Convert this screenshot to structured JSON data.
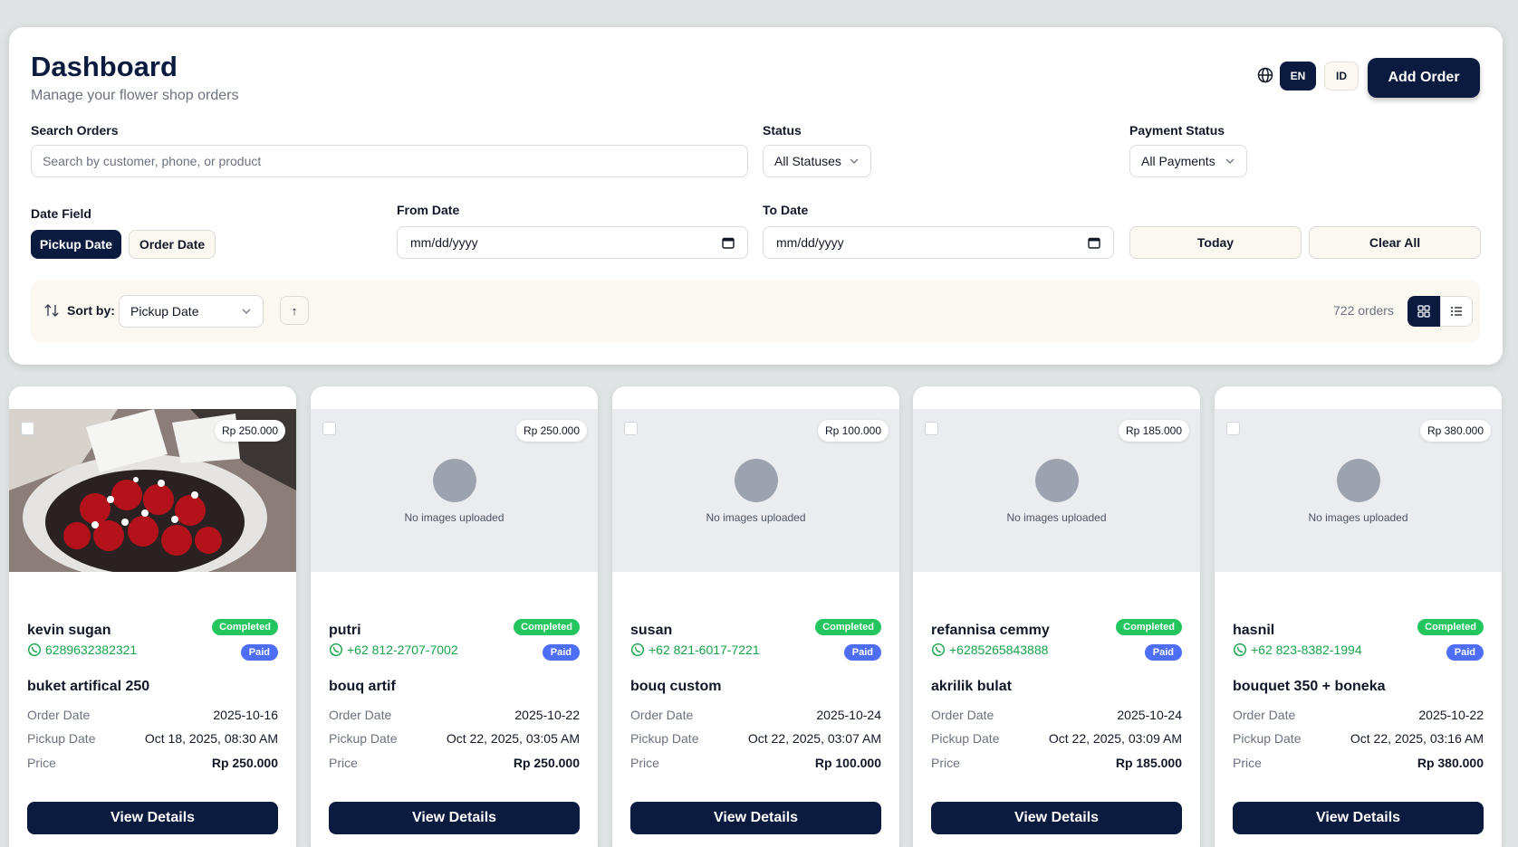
{
  "header": {
    "title": "Dashboard",
    "subtitle": "Manage your flower shop orders",
    "lang_en": "EN",
    "lang_id": "ID",
    "add_order": "Add Order"
  },
  "filters": {
    "search_label": "Search Orders",
    "search_placeholder": "Search by customer, phone, or product",
    "status_label": "Status",
    "status_value": "All Statuses",
    "payment_label": "Payment Status",
    "payment_value": "All Payments",
    "date_field_label": "Date Field",
    "pickup_date": "Pickup Date",
    "order_date": "Order Date",
    "from_label": "From Date",
    "from_value": "mm/dd/yyyy",
    "to_label": "To Date",
    "to_value": "mm/dd/yyyy",
    "today": "Today",
    "clear_all": "Clear All"
  },
  "sort": {
    "label": "Sort by:",
    "value": "Pickup Date",
    "direction": "↑",
    "count": "722 orders"
  },
  "card_labels": {
    "no_images": "No images uploaded",
    "order_date": "Order Date",
    "pickup_date": "Pickup Date",
    "price": "Price",
    "view_details": "View Details"
  },
  "orders": [
    {
      "customer": "kevin sugan",
      "phone": "6289632382321",
      "status": "Completed",
      "payment": "Paid",
      "product": "buket artifical 250",
      "order_date": "2025-10-16",
      "pickup_date": "Oct 18, 2025, 08:30 AM",
      "price": "Rp 250.000",
      "has_image": true
    },
    {
      "customer": "putri",
      "phone": "+62 812-2707-7002",
      "status": "Completed",
      "payment": "Paid",
      "product": "bouq artif",
      "order_date": "2025-10-22",
      "pickup_date": "Oct 22, 2025, 03:05 AM",
      "price": "Rp 250.000",
      "has_image": false
    },
    {
      "customer": "susan",
      "phone": "+62 821-6017-7221",
      "status": "Completed",
      "payment": "Paid",
      "product": "bouq custom",
      "order_date": "2025-10-24",
      "pickup_date": "Oct 22, 2025, 03:07 AM",
      "price": "Rp 100.000",
      "has_image": false
    },
    {
      "customer": "refannisa cemmy",
      "phone": "+6285265843888",
      "status": "Completed",
      "payment": "Paid",
      "product": "akrilik bulat",
      "order_date": "2025-10-24",
      "pickup_date": "Oct 22, 2025, 03:09 AM",
      "price": "Rp 185.000",
      "has_image": false
    },
    {
      "customer": "hasnil",
      "phone": "+62 823-8382-1994",
      "status": "Completed",
      "payment": "Paid",
      "product": "bouquet 350 + boneka",
      "order_date": "2025-10-22",
      "pickup_date": "Oct 22, 2025, 03:16 AM",
      "price": "Rp 380.000",
      "has_image": false
    }
  ]
}
